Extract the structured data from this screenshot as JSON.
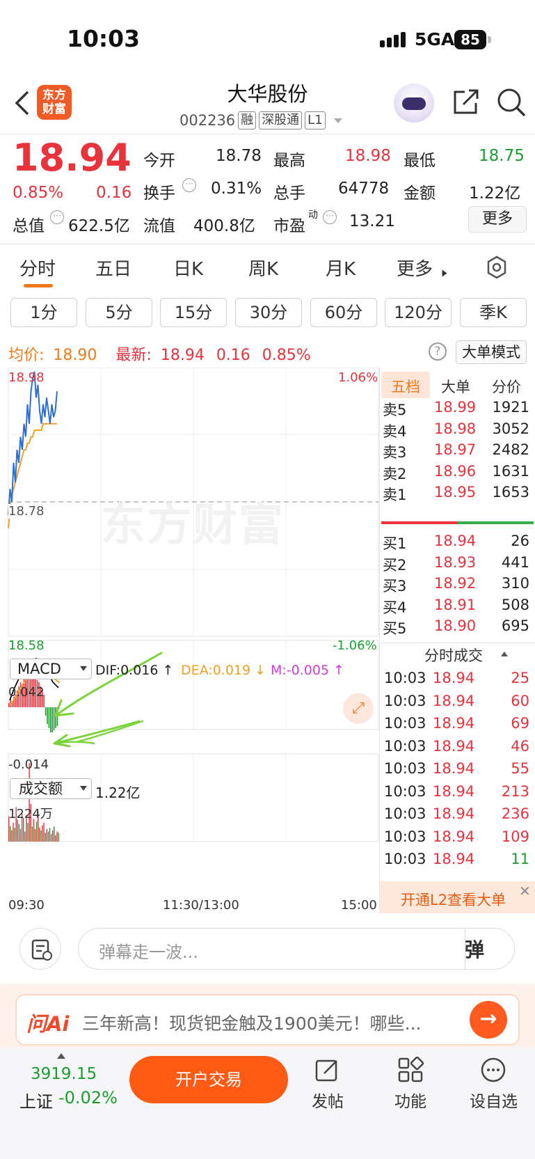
{
  "status": {
    "time": "10:03",
    "network": "5GA",
    "battery": "85"
  },
  "nav": {
    "logo_text": "东方\n财富",
    "stock_name": "大华股份",
    "stock_code": "002236",
    "tag_rong": "融",
    "tag_connect": "深股通",
    "tag_level": "L1"
  },
  "quote": {
    "price": "18.94",
    "change_pct": "0.85%",
    "change": "0.16",
    "open_label": "今开",
    "open": "18.78",
    "high_label": "最高",
    "high": "18.98",
    "low_label": "最低",
    "low": "18.75",
    "turnover_label": "换手",
    "turnover": "0.31%",
    "volume_label": "总手",
    "volume": "64778",
    "amount_label": "金额",
    "amount": "1.22亿",
    "mktcap_label": "总值",
    "mktcap": "622.5亿",
    "float_label": "流值",
    "float": "400.8亿",
    "pe_label": "市盈",
    "pe_sup": "动",
    "pe": "13.21",
    "more_btn": "更多"
  },
  "tabs": [
    "分时",
    "五日",
    "日K",
    "周K",
    "月K",
    "更多"
  ],
  "periods": [
    "1分",
    "5分",
    "15分",
    "30分",
    "60分",
    "120分",
    "季K"
  ],
  "info": {
    "avg_label": "均价:",
    "avg": "18.90",
    "latest_label": "最新:",
    "latest": "18.94",
    "latest_chg": "0.16",
    "latest_pct": "0.85%",
    "bigorder_btn": "大单模式"
  },
  "chart_labels": {
    "ymax": "18.98",
    "ymid": "18.78",
    "ymin": "18.58",
    "pmax": "1.06%",
    "pmin": "-1.06%",
    "watermark": "东方财富",
    "macd_select": "MACD",
    "dif": "DIF:0.016 ↑",
    "dea": "DEA:0.019 ↓",
    "m": "M:-0.005 ↑",
    "macd_max": "0.042",
    "macd_min": "-0.014",
    "vol_select": "成交额",
    "vol_total": "1.22亿",
    "vol_max": "1224万",
    "t_start": "09:30",
    "t_mid": "11:30/13:00",
    "t_end": "15:00"
  },
  "chart_data": {
    "type": "line",
    "x_label_ticks": [
      "09:30",
      "11:30/13:00",
      "15:00"
    ],
    "ylim": [
      18.58,
      18.98
    ],
    "prev_close": 18.78,
    "series": [
      {
        "name": "最新",
        "color": "#2f6fd0",
        "values": [
          18.76,
          18.8,
          18.78,
          18.84,
          18.81,
          18.86,
          18.84,
          18.88,
          18.86,
          18.9,
          18.88,
          18.93,
          18.9,
          18.95,
          18.97,
          18.98,
          18.94,
          18.96,
          18.92,
          18.9,
          18.93,
          18.91,
          18.94,
          18.92,
          18.9,
          18.93,
          18.91,
          18.92,
          18.95
        ]
      },
      {
        "name": "均价",
        "color": "#f0a020",
        "values": [
          18.74,
          18.77,
          18.79,
          18.8,
          18.81,
          18.82,
          18.83,
          18.84,
          18.85,
          18.86,
          18.86,
          18.87,
          18.87,
          18.88,
          18.88,
          18.89,
          18.89,
          18.89,
          18.89,
          18.89,
          18.9,
          18.9,
          18.9,
          18.9,
          18.9,
          18.9,
          18.9,
          18.9,
          18.9
        ]
      }
    ]
  },
  "sidebar": {
    "tabs": [
      "五档",
      "大单",
      "分价"
    ],
    "asks": [
      {
        "label": "卖5",
        "price": "18.99",
        "vol": "1921"
      },
      {
        "label": "卖4",
        "price": "18.98",
        "vol": "3052"
      },
      {
        "label": "卖3",
        "price": "18.97",
        "vol": "2482"
      },
      {
        "label": "卖2",
        "price": "18.96",
        "vol": "1631"
      },
      {
        "label": "卖1",
        "price": "18.95",
        "vol": "1653"
      }
    ],
    "bids": [
      {
        "label": "买1",
        "price": "18.94",
        "vol": "26"
      },
      {
        "label": "买2",
        "price": "18.93",
        "vol": "441"
      },
      {
        "label": "买3",
        "price": "18.92",
        "vol": "310"
      },
      {
        "label": "买4",
        "price": "18.91",
        "vol": "508"
      },
      {
        "label": "买5",
        "price": "18.90",
        "vol": "695"
      }
    ],
    "ticks_title": "分时成交",
    "ticks": [
      {
        "time": "10:03",
        "price": "18.94",
        "vol": "25",
        "color": "#e8323c"
      },
      {
        "time": "10:03",
        "price": "18.94",
        "vol": "60",
        "color": "#e8323c"
      },
      {
        "time": "10:03",
        "price": "18.94",
        "vol": "69",
        "color": "#e8323c"
      },
      {
        "time": "10:03",
        "price": "18.94",
        "vol": "46",
        "color": "#e8323c"
      },
      {
        "time": "10:03",
        "price": "18.94",
        "vol": "55",
        "color": "#e8323c"
      },
      {
        "time": "10:03",
        "price": "18.94",
        "vol": "213",
        "color": "#e8323c"
      },
      {
        "time": "10:03",
        "price": "18.94",
        "vol": "236",
        "color": "#e8323c"
      },
      {
        "time": "10:03",
        "price": "18.94",
        "vol": "109",
        "color": "#e8323c"
      },
      {
        "time": "10:03",
        "price": "18.94",
        "vol": "11",
        "color": "#1a9e2e"
      }
    ],
    "l2_text": "开通L2查看大单"
  },
  "danmu": {
    "placeholder": "弹幕走一波...",
    "btn": "弹"
  },
  "ai": {
    "logo": "问Ai",
    "text": "三年新高！现货钯金触及1900美元！哪些..."
  },
  "bottom": {
    "index_value": "3919.15",
    "index_name": "上证",
    "index_change": "-0.02%",
    "trade_btn": "开户交易",
    "post": "发帖",
    "func": "功能",
    "watch": "设自选"
  },
  "colors": {
    "up": "#e8323c",
    "down": "#1a9e2e",
    "accent": "#f07a1a"
  }
}
